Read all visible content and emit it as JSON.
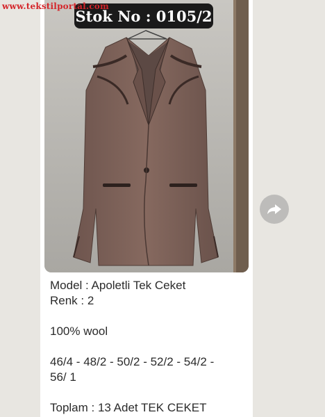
{
  "watermark": "www.tekstilportal.com",
  "badge": {
    "label": "Stok No : 0105/2"
  },
  "caption": {
    "line1": "Model : Apoletli Tek Ceket",
    "line2": "Renk : 2",
    "line3": "100% wool",
    "line4": "46/4 - 48/2 - 50/2 - 52/2 - 54/2 -",
    "line5": "56/ 1",
    "line6": "Toplam : 13 Adet TEK CEKET"
  },
  "icons": {
    "share": "forward-arrow-icon",
    "photo": "jacket-photo"
  },
  "colors": {
    "watermark": "#d4252a",
    "badge_bg": "#1a1a1a",
    "jacket": "#7a6058",
    "share_bg": "#bdbcba"
  }
}
